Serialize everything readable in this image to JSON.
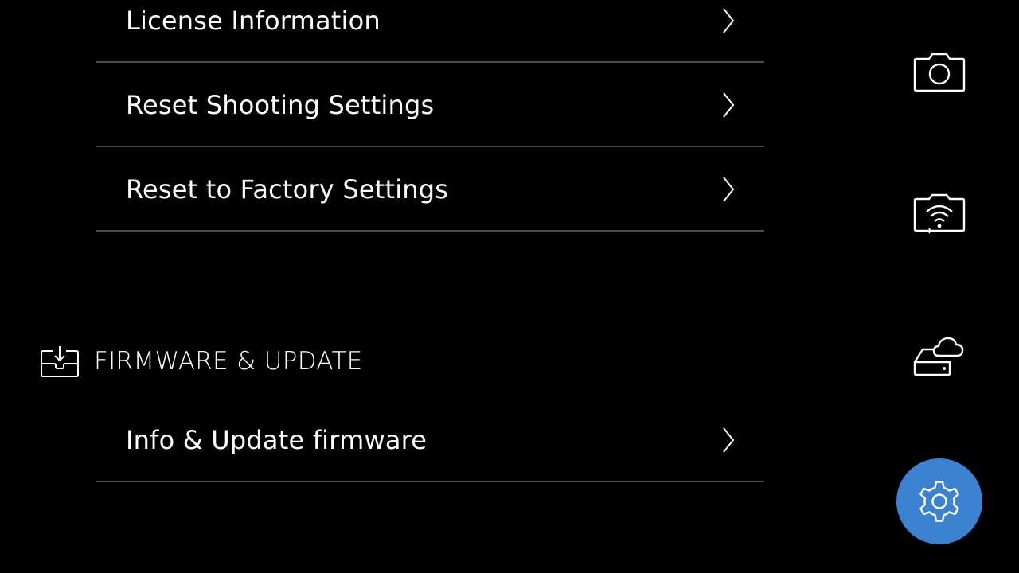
{
  "menu": {
    "items": [
      {
        "label": "License Information"
      },
      {
        "label": "Reset Shooting Settings"
      },
      {
        "label": "Reset to Factory Settings"
      }
    ]
  },
  "firmware_section": {
    "title": "FIRMWARE & UPDATE",
    "icon": "download-tray-icon",
    "items": [
      {
        "label": "Info & Update firmware"
      }
    ]
  },
  "side_nav": {
    "items": [
      {
        "icon": "camera-icon",
        "active": false
      },
      {
        "icon": "camera-wifi-icon",
        "active": false
      },
      {
        "icon": "cloud-storage-icon",
        "active": false
      },
      {
        "icon": "gear-icon",
        "active": true
      }
    ],
    "active_color": "#3b82d0"
  },
  "colors": {
    "background": "#000000",
    "text": "#ffffff",
    "divider": "#4a4a4a",
    "accent": "#3b82d0"
  }
}
